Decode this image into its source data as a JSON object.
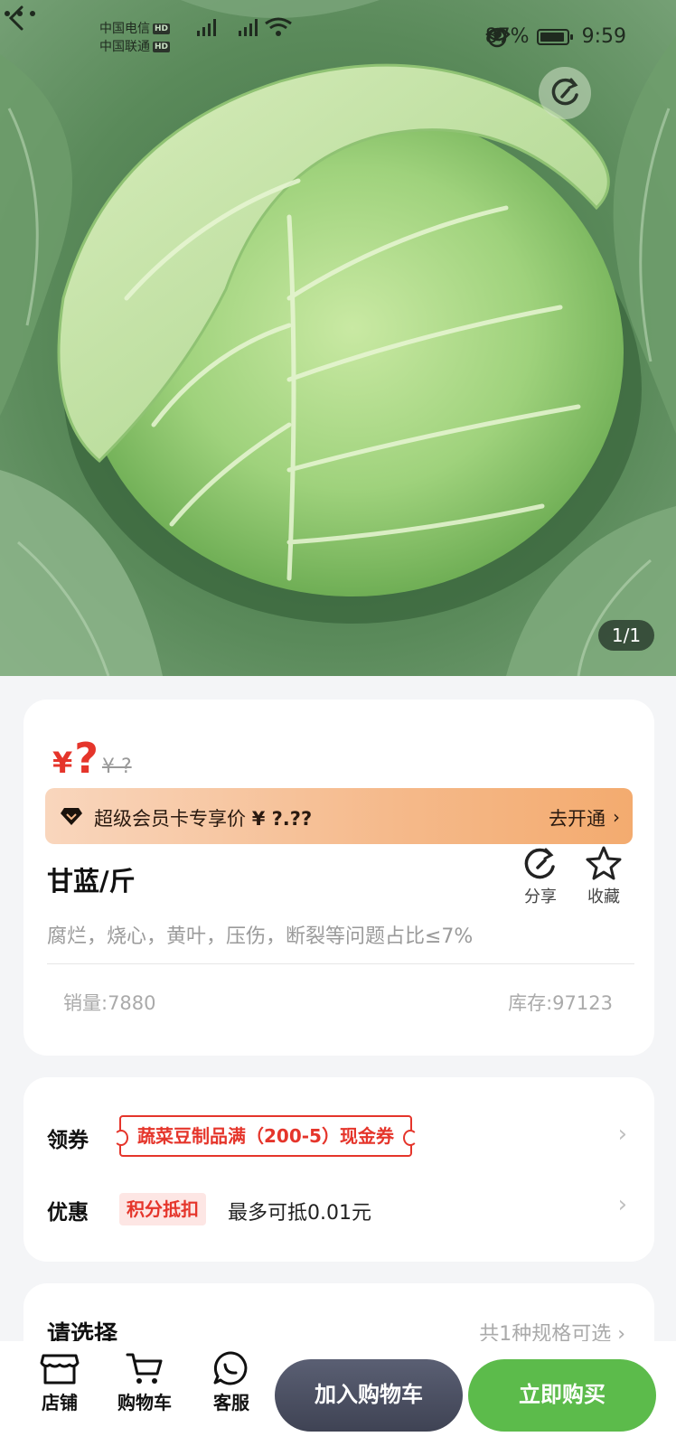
{
  "status_bar": {
    "carrier1": "中国电信",
    "carrier2": "中国联通",
    "hd": "HD",
    "battery": "87%",
    "time": "9:59"
  },
  "hero": {
    "image_icon": "cabbage-photo",
    "counter": "1/1"
  },
  "product": {
    "price_symbol": "¥",
    "price_value": "?",
    "price_old": "¥ ?",
    "vip_text": "超级会员卡专享价",
    "vip_price": "¥ ?.??",
    "vip_open": "去开通",
    "title": "甘蓝/斤",
    "share_label": "分享",
    "fav_label": "收藏",
    "description": "腐烂，烧心，黄叶，压伤，断裂等问题占比≤7%",
    "sales": "销量:7880",
    "stock": "库存:97123"
  },
  "coupon": {
    "label": "领券",
    "tag": "蔬菜豆制品满（200-5）现金券",
    "promo_label": "优惠",
    "points_tag": "积分抵扣",
    "points_text": "最多可抵0.01元"
  },
  "select": {
    "title": "请选择",
    "hint": "共1种规格可选"
  },
  "bottom": {
    "store": "店铺",
    "cart": "购物车",
    "service": "客服",
    "add_cart": "加入购物车",
    "buy_now": "立即购买"
  },
  "colors": {
    "accent_red": "#e5352b",
    "buy_green": "#5cbb4b",
    "cart_dark": "#3f4354"
  }
}
